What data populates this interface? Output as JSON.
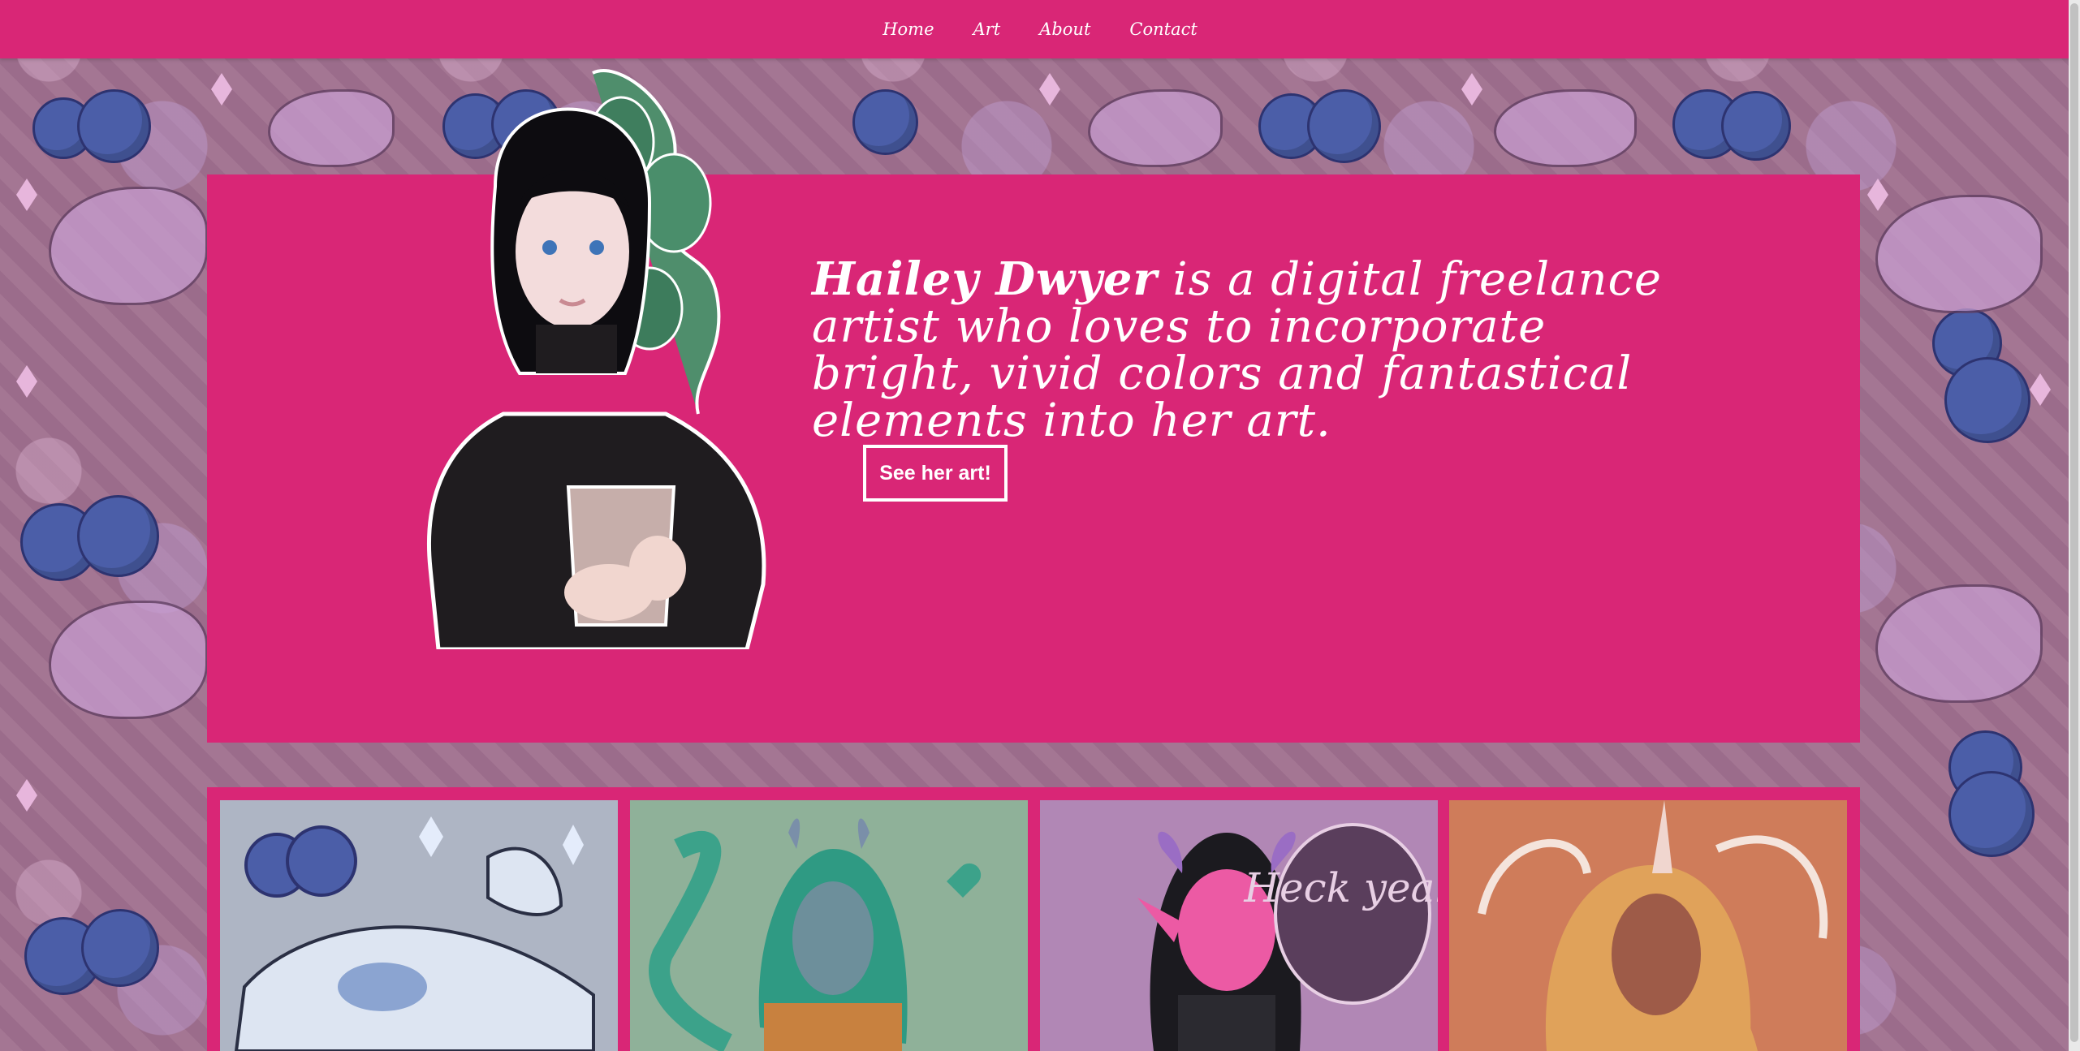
{
  "nav": {
    "items": [
      "Home",
      "Art",
      "About",
      "Contact"
    ]
  },
  "hero": {
    "name": "Hailey Dwyer",
    "tagline": " is a digital freelance artist who loves to incorporate bright, vivid colors and fantastical elements into her art.",
    "cta_label": "See her art!"
  },
  "gallery": {
    "tiles": [
      "cow-berries-artwork",
      "teal-hair-character-artwork",
      "pink-demon-character-artwork",
      "unicorn-character-artwork"
    ],
    "tile3_speech": "Heck yeah"
  },
  "colors": {
    "brand": "#d92676",
    "background": "#a0708f"
  }
}
